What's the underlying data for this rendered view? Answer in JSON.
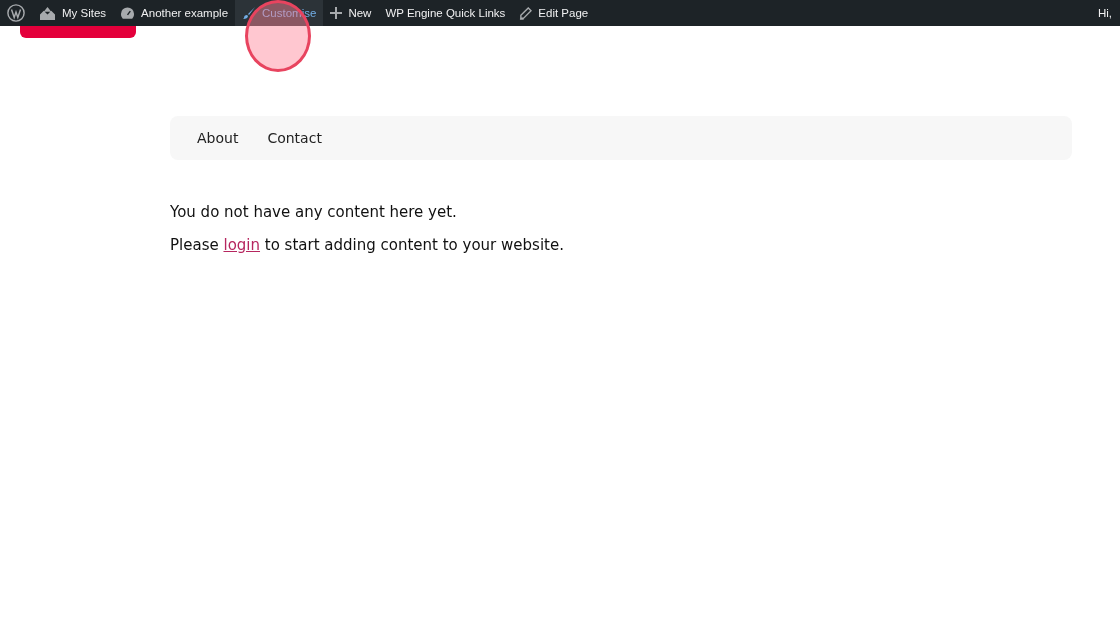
{
  "admin_bar": {
    "items": [
      {
        "kind": "logo",
        "selected": false
      },
      {
        "kind": "sites",
        "label": "My Sites",
        "selected": false
      },
      {
        "kind": "site",
        "label": "Another example",
        "selected": false
      },
      {
        "kind": "brush",
        "label": "Customise",
        "selected": true
      },
      {
        "kind": "plus",
        "label": "New",
        "selected": false
      },
      {
        "kind": "text",
        "label": "WP Engine Quick Links",
        "selected": false
      },
      {
        "kind": "pencil",
        "label": "Edit Page",
        "selected": false
      }
    ],
    "greeting": "Hi,"
  },
  "nav": {
    "items": [
      "About",
      "Contact"
    ]
  },
  "content": {
    "message": "You do not have any content here yet.",
    "prompt": {
      "before": "Please",
      "link": "login",
      "after": "to start adding content to your website."
    }
  }
}
